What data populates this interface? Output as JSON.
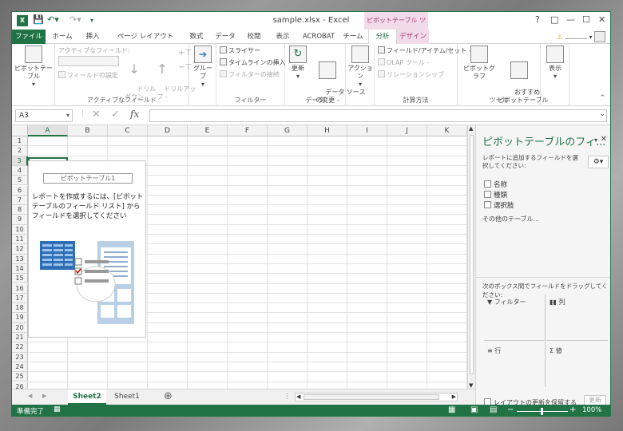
{
  "titlebar": {
    "app_logo": "X",
    "title": "sample.xlsx - Excel",
    "context_tools": "ピボットテーブル ツール",
    "help": "?",
    "restore": "□",
    "minimize": "—",
    "maximize": "☐",
    "close": "✕"
  },
  "tabs": {
    "file": "ファイル",
    "items": [
      "ホーム",
      "挿入",
      "ページ レイアウト",
      "数式",
      "データ",
      "校閲",
      "表示",
      "ACROBAT",
      "チーム"
    ],
    "analyze": "分析",
    "design": "デザイン"
  },
  "ribbon": {
    "pivot_table": "ピボットテーブル",
    "active_field_label": "アクティブなフィールド:",
    "field_settings": "フィールドの設定",
    "drilldown": "ドリル\nダウン",
    "drillup": "ドリルアッ\nプ -",
    "group_active_field": "アクティブなフィールド",
    "group": "グループ",
    "slicer": "スライサー",
    "timeline": "タイムラインの挿入",
    "filter_connect": "フィルターの接続",
    "group_filter": "フィルター",
    "refresh": "更新",
    "change_source": "データ ソース\nの変更 -",
    "group_data": "データ",
    "action": "アクション",
    "fields_items": "フィールド/アイテム/セット -",
    "olap": "OLAP ツール -",
    "relationship": "リレーションシップ",
    "group_calc": "計算方法",
    "pivot_chart": "ピボットグラフ",
    "recommended": "おすすめ\nピボットテーブル",
    "group_tools": "ツール",
    "show": "表示"
  },
  "formula_bar": {
    "name_box": "A3",
    "cancel": "✕",
    "enter": "✓",
    "fx": "fx"
  },
  "grid": {
    "columns": [
      "A",
      "B",
      "C",
      "D",
      "E",
      "F",
      "G",
      "H",
      "I",
      "J",
      "K"
    ],
    "rows": [
      "1",
      "2",
      "3",
      "4",
      "5",
      "6",
      "7",
      "8",
      "9",
      "10",
      "11",
      "12",
      "13",
      "14",
      "15",
      "16",
      "17",
      "18",
      "19",
      "20",
      "21",
      "22",
      "23",
      "24",
      "25",
      "26"
    ],
    "pivot_name": "ピボットテーブル1",
    "pivot_message": "レポートを作成するには、[ピボットテーブルのフィールド リスト] からフィールドを選択してください"
  },
  "pane": {
    "title": "ピボットテーブルのフィ...",
    "subtitle": "レポートに追加するフィールドを選択してください:",
    "fields": [
      "名称",
      "種類",
      "選択肢"
    ],
    "more_tables": "その他のテーブル...",
    "drag_label": "次のボックス間でフィールドをドラッグしてください:",
    "area_filter": "フィルター",
    "area_columns": "列",
    "area_rows": "行",
    "area_values": "値",
    "defer_update": "レイアウトの更新を保留する",
    "update": "更新"
  },
  "sheets": {
    "active": "Sheet2",
    "other": "Sheet1",
    "add": "⊕"
  },
  "status": {
    "ready": "準備完了",
    "zoom": "100%"
  },
  "colors": {
    "excel_green": "#217346",
    "context_pink": "#f2dbe9",
    "context_text": "#a4376c"
  }
}
